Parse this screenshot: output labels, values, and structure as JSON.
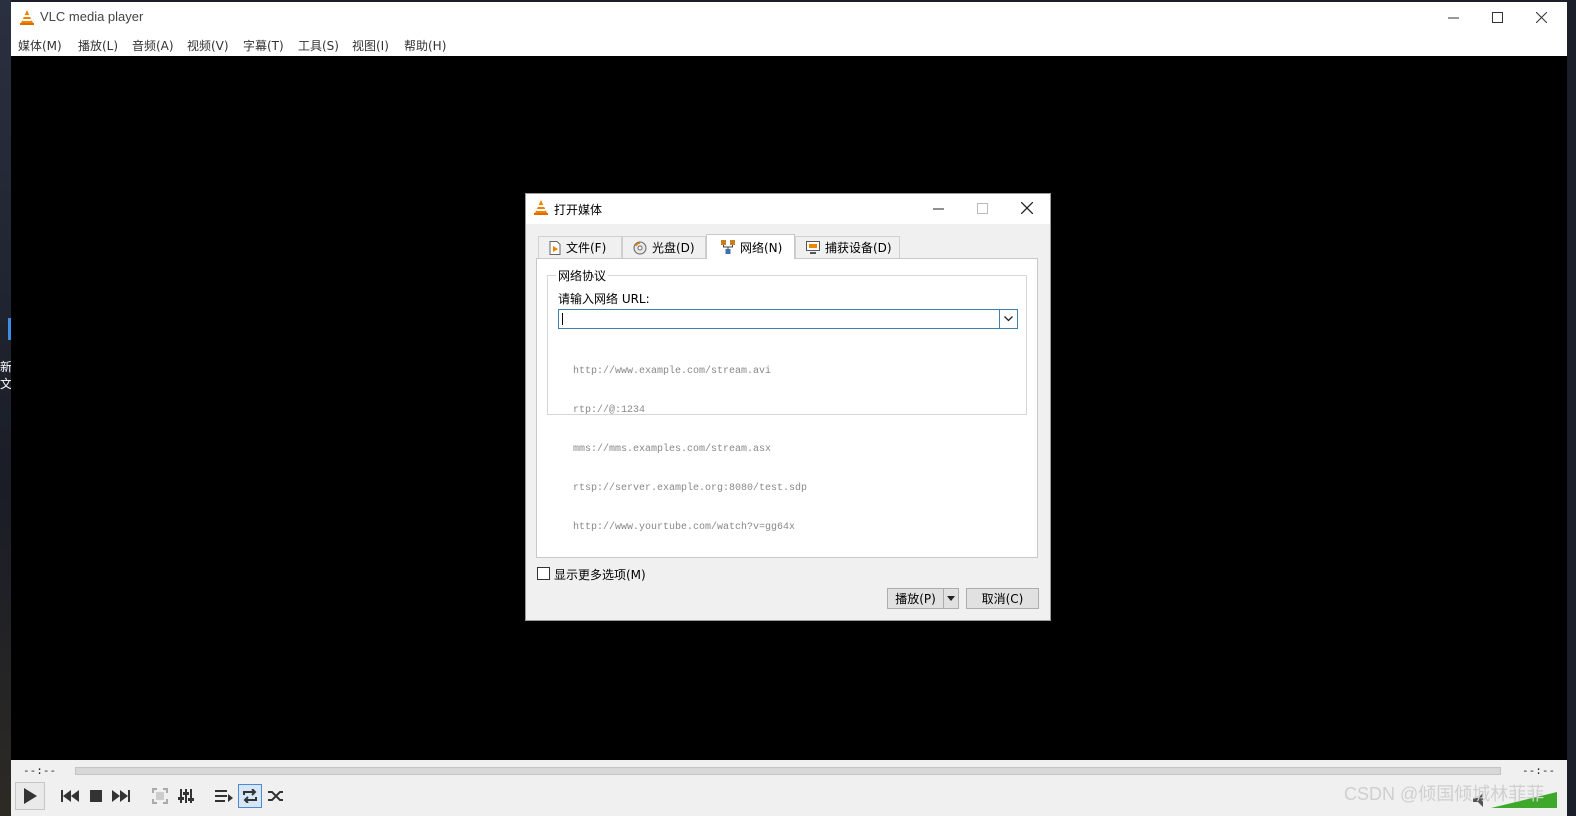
{
  "window": {
    "title": "VLC media player"
  },
  "menu": [
    "媒体(M)",
    "播放(L)",
    "音频(A)",
    "视频(V)",
    "字幕(T)",
    "工具(S)",
    "视图(I)",
    "帮助(H)"
  ],
  "desktop": {
    "text_a": "新",
    "text_b": "文"
  },
  "dialog": {
    "title": "打开媒体",
    "tabs": [
      {
        "label": "文件(F)",
        "icon": "file-icon"
      },
      {
        "label": "光盘(D)",
        "icon": "disc-icon"
      },
      {
        "label": "网络(N)",
        "icon": "network-icon",
        "selected": true
      },
      {
        "label": "捕获设备(D)",
        "icon": "capture-device-icon"
      }
    ],
    "group_title": "网络协议",
    "url_label": "请输入网络 URL:",
    "url_value": "",
    "examples": [
      "http://www.example.com/stream.avi",
      "rtp://@:1234",
      "mms://mms.examples.com/stream.asx",
      "rtsp://server.example.org:8080/test.sdp",
      "http://www.yourtube.com/watch?v=gg64x"
    ],
    "show_more_options": {
      "label": "显示更多选项(M)",
      "checked": false
    },
    "play_button": "播放(P)",
    "cancel_button": "取消(C)"
  },
  "playback": {
    "elapsed": "--:--",
    "remaining": "--:--",
    "progress": 0
  },
  "watermark": "CSDN @倾国倾城林菲菲",
  "colors": {
    "accent": "#3c7fb1",
    "video_bg": "#000000",
    "cone_orange": "#f08300"
  }
}
